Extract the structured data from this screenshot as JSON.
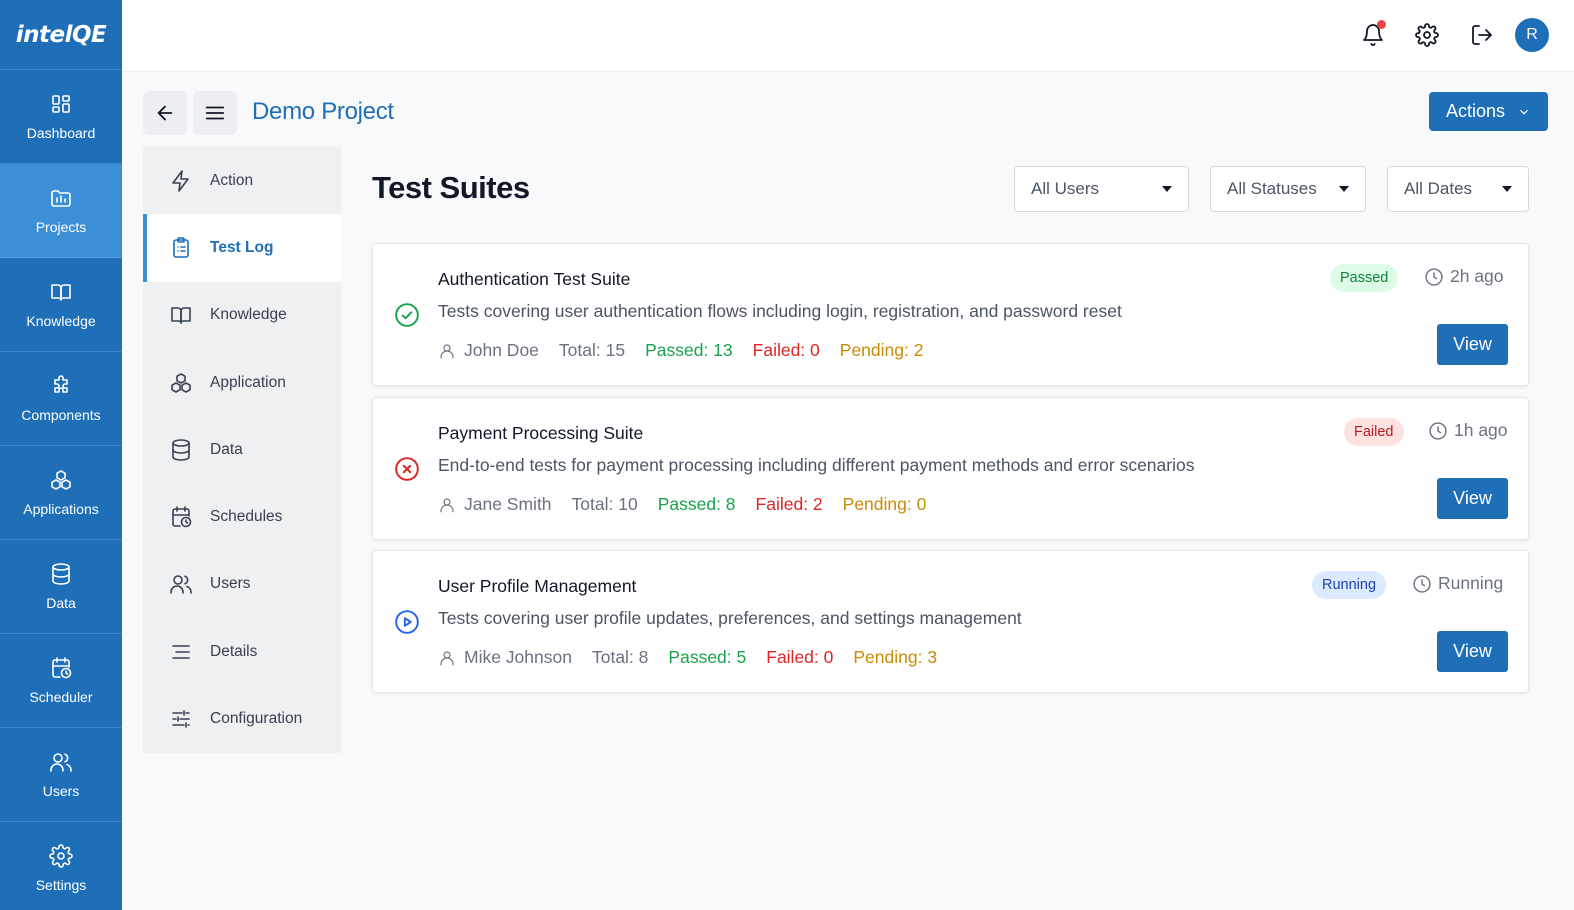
{
  "app": {
    "logo_text": "intelQE"
  },
  "rail": {
    "items": [
      {
        "label": "Dashboard",
        "icon": "dashboard-icon"
      },
      {
        "label": "Projects",
        "icon": "projects-icon",
        "active": true
      },
      {
        "label": "Knowledge",
        "icon": "book-icon"
      },
      {
        "label": "Components",
        "icon": "puzzle-icon"
      },
      {
        "label": "Applications",
        "icon": "cubes-icon"
      },
      {
        "label": "Data",
        "icon": "database-icon"
      },
      {
        "label": "Scheduler",
        "icon": "calendar-clock-icon"
      },
      {
        "label": "Users",
        "icon": "users-icon"
      },
      {
        "label": "Settings",
        "icon": "gear-icon"
      }
    ]
  },
  "topbar": {
    "avatar_initial": "R",
    "has_notification": true
  },
  "project": {
    "title": "Demo Project",
    "actions_label": "Actions"
  },
  "subnav": {
    "items": [
      {
        "label": "Action",
        "icon": "bolt-icon"
      },
      {
        "label": "Test Log",
        "icon": "clipboard-list-icon",
        "active": true
      },
      {
        "label": "Knowledge",
        "icon": "book-icon"
      },
      {
        "label": "Application",
        "icon": "cubes-icon"
      },
      {
        "label": "Data",
        "icon": "database-icon"
      },
      {
        "label": "Schedules",
        "icon": "calendar-clock-icon"
      },
      {
        "label": "Users",
        "icon": "users-icon"
      },
      {
        "label": "Details",
        "icon": "lines-icon"
      },
      {
        "label": "Configuration",
        "icon": "sliders-icon"
      }
    ]
  },
  "main": {
    "title": "Test Suites",
    "filters": [
      {
        "label": "All Users"
      },
      {
        "label": "All Statuses"
      },
      {
        "label": "All Dates"
      }
    ],
    "suites": [
      {
        "title": "Authentication Test Suite",
        "description": "Tests covering user authentication flows including login, registration, and password reset",
        "user": "John Doe",
        "total": "Total: 15",
        "passed": "Passed: 13",
        "failed": "Failed: 0",
        "pending": "Pending: 2",
        "status": "Passed",
        "status_icon": "check-circle-icon",
        "time": "2h ago",
        "view_label": "View"
      },
      {
        "title": "Payment Processing Suite",
        "description": "End-to-end tests for payment processing including different payment methods and error scenarios",
        "user": "Jane Smith",
        "total": "Total: 10",
        "passed": "Passed: 8",
        "failed": "Failed: 2",
        "pending": "Pending: 0",
        "status": "Failed",
        "status_icon": "x-circle-icon",
        "time": "1h ago",
        "view_label": "View"
      },
      {
        "title": "User Profile Management",
        "description": "Tests covering user profile updates, preferences, and settings management",
        "user": "Mike Johnson",
        "total": "Total: 8",
        "passed": "Passed: 5",
        "failed": "Failed: 0",
        "pending": "Pending: 3",
        "status": "Running",
        "status_icon": "play-circle-icon",
        "time": "Running",
        "view_label": "View"
      }
    ]
  },
  "colors": {
    "primary": "#1e6fb8",
    "rail_active": "#3a8fd6",
    "passed": "#16a34a",
    "failed": "#dc2626",
    "pending": "#ca8a04"
  }
}
